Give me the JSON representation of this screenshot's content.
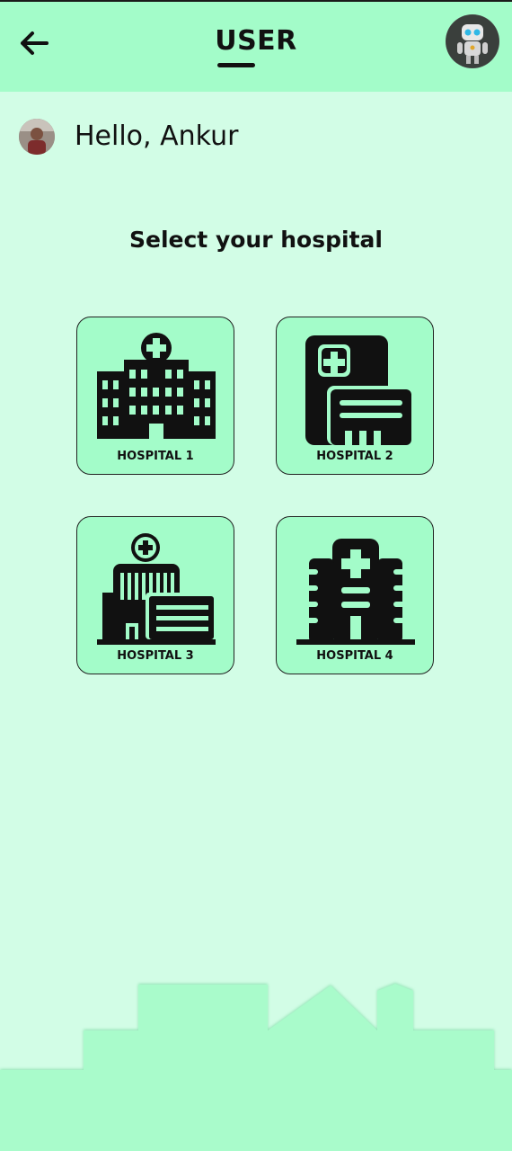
{
  "header": {
    "back_icon": "arrow-left-icon",
    "title": "USER",
    "assistant_avatar_icon": "robot-avatar-icon"
  },
  "user": {
    "greeting": "Hello, Ankur",
    "avatar_icon": "user-photo-avatar"
  },
  "main": {
    "heading": "Select your hospital",
    "hospitals": [
      {
        "label": "HOSPITAL 1",
        "icon": "hospital-building-1-icon"
      },
      {
        "label": "HOSPITAL 2",
        "icon": "hospital-building-2-icon"
      },
      {
        "label": "HOSPITAL 3",
        "icon": "hospital-building-3-icon"
      },
      {
        "label": "HOSPITAL 4",
        "icon": "hospital-building-4-icon"
      }
    ]
  },
  "colors": {
    "background": "#d2fde6",
    "header": "#a3fcc9",
    "card": "#a3fcc9",
    "skyline": "#a9fbcb",
    "text": "#111111"
  }
}
